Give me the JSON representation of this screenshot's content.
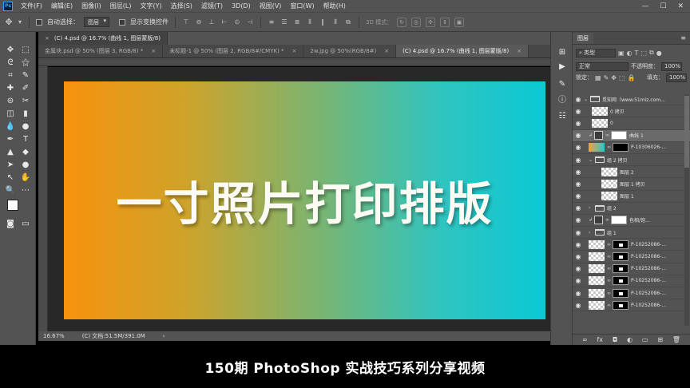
{
  "menubar": {
    "logo": "Ps",
    "items": [
      "文件(F)",
      "编辑(E)",
      "图像(I)",
      "图层(L)",
      "文字(Y)",
      "选择(S)",
      "滤镜(T)",
      "3D(D)",
      "视图(V)",
      "窗口(W)",
      "帮助(H)"
    ],
    "window_buttons": [
      "—",
      "☐",
      "✕"
    ]
  },
  "options": {
    "auto_select_label": "自动选择：",
    "auto_select_value": "图层",
    "show_transform_label": "显示变换控件",
    "mode_3d_label": "3D 模式："
  },
  "tabs": {
    "window_title": "(C) 4.psd @ 16.7% (曲线 1, 图层蒙版/8)",
    "docs": [
      {
        "label": "金属块.psd @ 50% (图层 3, RGB/8) *",
        "active": false
      },
      {
        "label": "未标题-1 @ 50% (图层 2, RGB/8#/CMYK) *",
        "active": false
      },
      {
        "label": "2w.jpg @ 50%(RGB/8#)",
        "active": false
      },
      {
        "label": "(C) 4.psd @ 16.7% (曲线 1, 图层蒙版/8)",
        "active": true
      }
    ],
    "close_glyph": "×"
  },
  "canvas": {
    "headline": "一寸照片打印排版",
    "gradient_from": "#f7920d",
    "gradient_to": "#0bc9d5"
  },
  "status": {
    "zoom": "16.67%",
    "doc_info": "(C) 文档:51.5M/391.0M",
    "arrow": "›"
  },
  "layers_panel": {
    "title": "图层",
    "filter_label": "类型",
    "blend_mode": "正常",
    "opacity_label": "不透明度：",
    "opacity_value": "100%",
    "lock_label": "锁定：",
    "fill_label": "填充：",
    "fill_value": "100%",
    "layers": [
      {
        "name": "觅知网（www.51miz.com...",
        "kind": "group",
        "indent": 0,
        "open": true
      },
      {
        "name": "0 拷贝",
        "kind": "pixel",
        "indent": 1
      },
      {
        "name": "0",
        "kind": "pixel",
        "indent": 1
      },
      {
        "name": "曲线 1",
        "kind": "adjustment",
        "indent": 1,
        "selected": true
      },
      {
        "name": "P-10306026-...",
        "kind": "photo",
        "indent": 1
      },
      {
        "name": "组 2 拷贝",
        "kind": "group",
        "indent": 1,
        "open": true
      },
      {
        "name": "图层 2",
        "kind": "pixel",
        "indent": 2
      },
      {
        "name": "图层 1 拷贝",
        "kind": "pixel",
        "indent": 2
      },
      {
        "name": "图层 1",
        "kind": "pixel",
        "indent": 2
      },
      {
        "name": "组 2",
        "kind": "group",
        "indent": 1,
        "open": false
      },
      {
        "name": "色相/饱...",
        "kind": "adjustment",
        "indent": 1
      },
      {
        "name": "组 1",
        "kind": "group",
        "indent": 1,
        "open": false
      },
      {
        "name": "P-10252086-...",
        "kind": "photo",
        "indent": 1
      },
      {
        "name": "P-10252086-...",
        "kind": "photo",
        "indent": 1
      },
      {
        "name": "P-10252086-...",
        "kind": "photo",
        "indent": 1
      },
      {
        "name": "P-10252086-...",
        "kind": "photo",
        "indent": 1
      },
      {
        "name": "P-10252086-...",
        "kind": "photo",
        "indent": 1
      },
      {
        "name": "P-10252086-...",
        "kind": "photo",
        "indent": 1
      }
    ],
    "footer_icons": [
      "link-icon",
      "fx-icon",
      "mask-icon",
      "adjustment-icon",
      "folder-icon",
      "new-layer-icon",
      "trash-icon"
    ]
  },
  "caption": {
    "text": "150期 PhotoShop 实战技巧系列分享视频"
  }
}
